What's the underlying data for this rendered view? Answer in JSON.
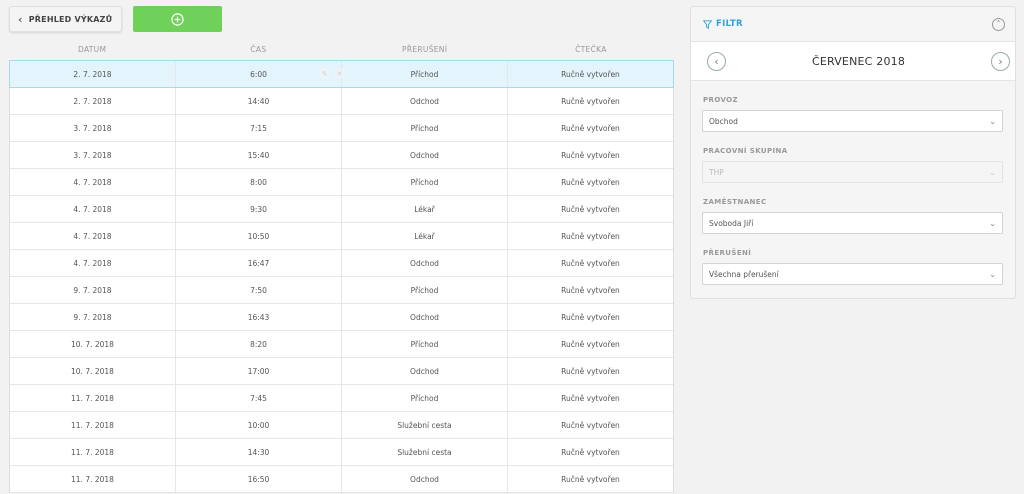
{
  "toolbar": {
    "back_label": "PŘEHLED VÝKAZŮ",
    "add_icon": "plus-circle-icon",
    "add_color": "#6fd05a"
  },
  "table": {
    "columns": [
      "DATUM",
      "ČAS",
      "PŘERUŠENÍ",
      "ČTEČKA"
    ],
    "rows": [
      {
        "date": "2. 7. 2018",
        "time": "6:00",
        "break": "Příchod",
        "reader": "Ručně vytvořen",
        "selected": true
      },
      {
        "date": "2. 7. 2018",
        "time": "14:40",
        "break": "Odchod",
        "reader": "Ručně vytvořen"
      },
      {
        "date": "3. 7. 2018",
        "time": "7:15",
        "break": "Příchod",
        "reader": "Ručně vytvořen"
      },
      {
        "date": "3. 7. 2018",
        "time": "15:40",
        "break": "Odchod",
        "reader": "Ručně vytvořen"
      },
      {
        "date": "4. 7. 2018",
        "time": "8:00",
        "break": "Příchod",
        "reader": "Ručně vytvořen"
      },
      {
        "date": "4. 7. 2018",
        "time": "9:30",
        "break": "Lékař",
        "reader": "Ručně vytvořen"
      },
      {
        "date": "4. 7. 2018",
        "time": "10:50",
        "break": "Lékař",
        "reader": "Ručně vytvořen"
      },
      {
        "date": "4. 7. 2018",
        "time": "16:47",
        "break": "Odchod",
        "reader": "Ručně vytvořen"
      },
      {
        "date": "9. 7. 2018",
        "time": "7:50",
        "break": "Příchod",
        "reader": "Ručně vytvořen"
      },
      {
        "date": "9. 7. 2018",
        "time": "16:43",
        "break": "Odchod",
        "reader": "Ručně vytvořen"
      },
      {
        "date": "10. 7. 2018",
        "time": "8:20",
        "break": "Příchod",
        "reader": "Ručně vytvořen"
      },
      {
        "date": "10. 7. 2018",
        "time": "17:00",
        "break": "Odchod",
        "reader": "Ručně vytvořen"
      },
      {
        "date": "11. 7. 2018",
        "time": "7:45",
        "break": "Příchod",
        "reader": "Ručně vytvořen"
      },
      {
        "date": "11. 7. 2018",
        "time": "10:00",
        "break": "Služební cesta",
        "reader": "Ručně vytvořen"
      },
      {
        "date": "11. 7. 2018",
        "time": "14:30",
        "break": "Služební cesta",
        "reader": "Ručně vytvořen"
      },
      {
        "date": "11. 7. 2018",
        "time": "16:50",
        "break": "Odchod",
        "reader": "Ručně vytvořen"
      }
    ]
  },
  "filter": {
    "title": "FILTR",
    "accent": "#2aa4d8",
    "month": "ČERVENEC 2018",
    "fields": [
      {
        "label": "PROVOZ",
        "value": "Obchod",
        "disabled": false
      },
      {
        "label": "PRACOVNÍ SKUPINA",
        "value": "THP",
        "disabled": true
      },
      {
        "label": "ZAMĚSTNANEC",
        "value": "Svoboda Jiří",
        "disabled": false
      },
      {
        "label": "PŘERUŠENÍ",
        "value": "Všechna přerušení",
        "disabled": false
      }
    ]
  }
}
